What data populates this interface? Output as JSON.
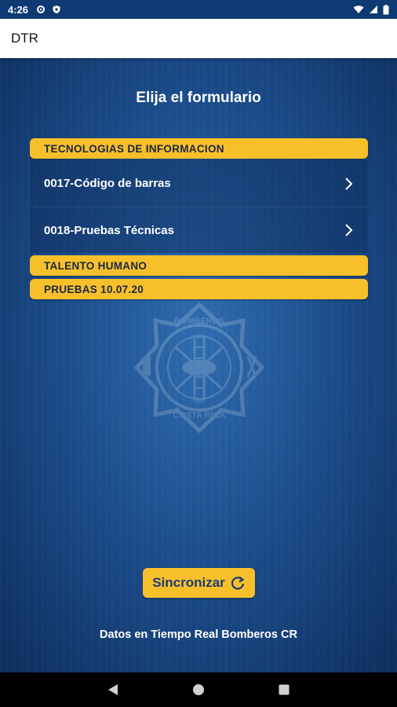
{
  "status_bar": {
    "time": "4:26",
    "icons": [
      "settings-icon",
      "shield-icon",
      "wifi-icon",
      "signal-icon",
      "battery-icon"
    ]
  },
  "app_bar": {
    "title": "DTR"
  },
  "main": {
    "heading": "Elija el formulario",
    "groups": [
      {
        "title": "TECNOLOGIAS DE INFORMACION",
        "items": [
          {
            "label": "0017-Código de barras"
          },
          {
            "label": "0018-Pruebas Técnicas"
          }
        ]
      },
      {
        "title": "TALENTO HUMANO",
        "items": []
      },
      {
        "title": "PRUEBAS 10.07.20",
        "items": []
      }
    ],
    "emblem": {
      "top_text": "BOMBEROS",
      "bottom_text": "COSTA RICA",
      "year": "1865"
    },
    "sync_button": {
      "label": "Sincronizar",
      "icon": "refresh-icon"
    },
    "footer": "Datos en Tiempo Real Bomberos CR"
  },
  "nav_bar": {
    "icons": [
      "back-icon",
      "home-icon",
      "recents-icon"
    ]
  },
  "colors": {
    "accent": "#f7c02b",
    "background": "#1d4f8f",
    "text_dark": "#1a2540"
  }
}
